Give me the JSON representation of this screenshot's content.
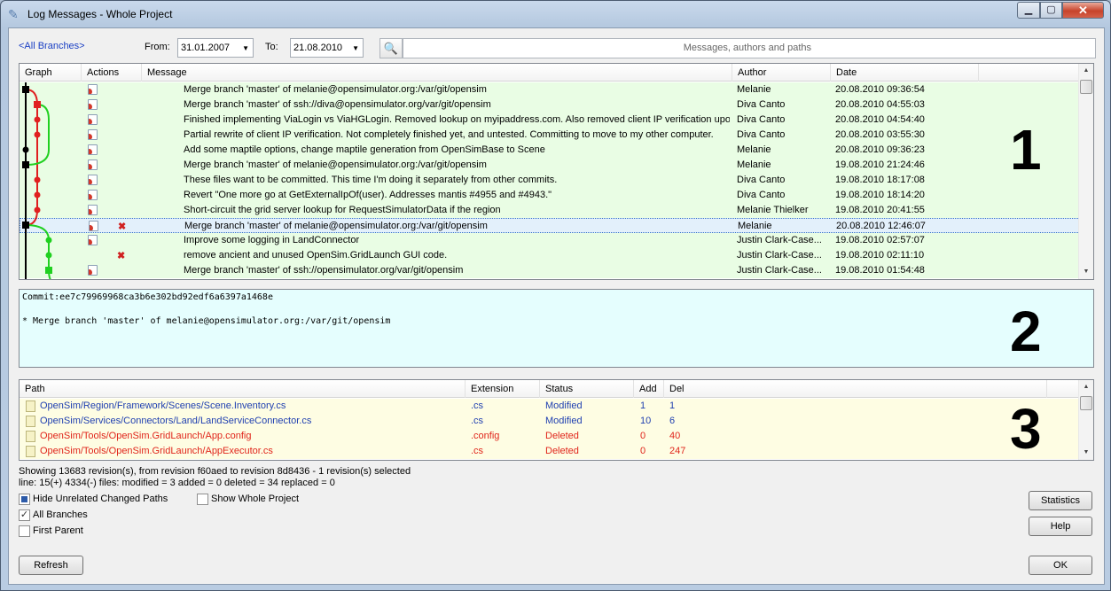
{
  "window": {
    "title": "Log Messages - Whole Project"
  },
  "filter": {
    "branch_link": "<All Branches>",
    "from_label": "From:",
    "from_value": "31.01.2007",
    "to_label": "To:",
    "to_value": "21.08.2010",
    "search_placeholder": "Messages, authors and paths"
  },
  "log": {
    "columns": [
      "Graph",
      "Actions",
      "Message",
      "Author",
      "Date"
    ],
    "rows": [
      {
        "rev": "r/13660",
        "message": "Merge branch 'master' of melanie@opensimulator.org:/var/git/opensim",
        "author": "Melanie",
        "date": "20.08.2010 09:36:54",
        "action2": false
      },
      {
        "rev": "r/13651",
        "message": "Merge branch 'master' of ssh://diva@opensimulator.org/var/git/opensim",
        "author": "Diva Canto",
        "date": "20.08.2010 04:55:03",
        "action2": false
      },
      {
        "rev": "r/13650",
        "message": "Finished implementing ViaLogin vs ViaHGLogin. Removed lookup on myipaddress.com. Also removed client IP verification upon UDP",
        "author": "Diva Canto",
        "date": "20.08.2010 04:54:40",
        "action2": false
      },
      {
        "rev": "r/13649",
        "message": "Partial rewrite of client IP verification. Not completely finished yet, and untested. Committing to move to my other computer.",
        "author": "Diva Canto",
        "date": "20.08.2010 03:55:30",
        "action2": false
      },
      {
        "rev": "r/13659",
        "message": "Add some maptile options, change maptile generation from OpenSimBase to Scene",
        "author": "Melanie",
        "date": "20.08.2010 09:36:23",
        "action2": false
      },
      {
        "rev": "r/13648",
        "message": "Merge branch 'master' of melanie@opensimulator.org:/var/git/opensim",
        "author": "Melanie",
        "date": "19.08.2010 21:24:46",
        "action2": false
      },
      {
        "rev": "r/13646",
        "message": "These files want to be committed. This time I'm doing it separately from other commits.",
        "author": "Diva Canto",
        "date": "19.08.2010 18:17:08",
        "action2": false
      },
      {
        "rev": "r/13645",
        "message": "Revert \"One more go at GetExternalIpOf(user). Addresses mantis #4955 and #4943.\"",
        "author": "Diva Canto",
        "date": "19.08.2010 18:14:20",
        "action2": false
      },
      {
        "rev": "r/13647",
        "message": "Short-circuit the grid server lookup for RequestSimulatorData if the region",
        "author": "Melanie Thielker",
        "date": "19.08.2010 20:41:55",
        "action2": false
      },
      {
        "rev": "r/13644",
        "message": "Merge branch 'master' of melanie@opensimulator.org:/var/git/opensim",
        "author": "Melanie",
        "date": "20.08.2010 12:46:07",
        "action2": true,
        "selected": true
      },
      {
        "rev": "r/13642",
        "message": "Improve some logging in LandConnector",
        "author": "Justin Clark-Case...",
        "date": "19.08.2010 02:57:07",
        "action2": false
      },
      {
        "rev": "r/13641",
        "message": "remove ancient and unused OpenSim.GridLaunch GUI code.",
        "author": "Justin Clark-Case...",
        "date": "19.08.2010 02:11:10",
        "action2": true,
        "noaction1": true
      },
      {
        "rev": "r/13640",
        "message": "Merge branch 'master' of ssh://opensimulator.org/var/git/opensim",
        "author": "Justin Clark-Case...",
        "date": "19.08.2010 01:54:48",
        "action2": false
      }
    ]
  },
  "detail": {
    "commit_line": "Commit:ee7c79969968ca3b6e302bd92edf6a6397a1468e",
    "message_line": "* Merge branch 'master' of melanie@opensimulator.org:/var/git/opensim"
  },
  "files": {
    "columns": [
      "Path",
      "Extension",
      "Status",
      "Add",
      "Del"
    ],
    "rows": [
      {
        "path": "OpenSim/Region/Framework/Scenes/Scene.Inventory.cs",
        "ext": ".cs",
        "status": "Modified",
        "add": "1",
        "del": "1",
        "kind": "mod"
      },
      {
        "path": "OpenSim/Services/Connectors/Land/LandServiceConnector.cs",
        "ext": ".cs",
        "status": "Modified",
        "add": "10",
        "del": "6",
        "kind": "mod"
      },
      {
        "path": "OpenSim/Tools/OpenSim.GridLaunch/App.config",
        "ext": ".config",
        "status": "Deleted",
        "add": "0",
        "del": "40",
        "kind": "del"
      },
      {
        "path": "OpenSim/Tools/OpenSim.GridLaunch/AppExecutor.cs",
        "ext": ".cs",
        "status": "Deleted",
        "add": "0",
        "del": "247",
        "kind": "del"
      }
    ]
  },
  "annotations": {
    "one": "1",
    "two": "2",
    "three": "3"
  },
  "status": {
    "line1": "Showing 13683 revision(s), from revision f60aed to revision 8d8436 - 1 revision(s) selected",
    "line2": "line: 15(+) 4334(-) files: modified = 3 added = 0 deleted = 34 replaced = 0"
  },
  "options": {
    "hide_unrelated": "Hide Unrelated Changed Paths",
    "show_whole": "Show Whole Project",
    "all_branches": "All Branches",
    "first_parent": "First Parent"
  },
  "buttons": {
    "statistics": "Statistics",
    "help": "Help",
    "refresh": "Refresh",
    "ok": "OK"
  },
  "colors": {
    "graph_main": "#000000",
    "graph_red": "#e02020",
    "graph_green": "#20d020",
    "rev_highlight": "#ffff33",
    "log_row_bg": "#e9fde4",
    "detail_bg": "#e5fefe",
    "file_row_bg": "#fefde3"
  }
}
